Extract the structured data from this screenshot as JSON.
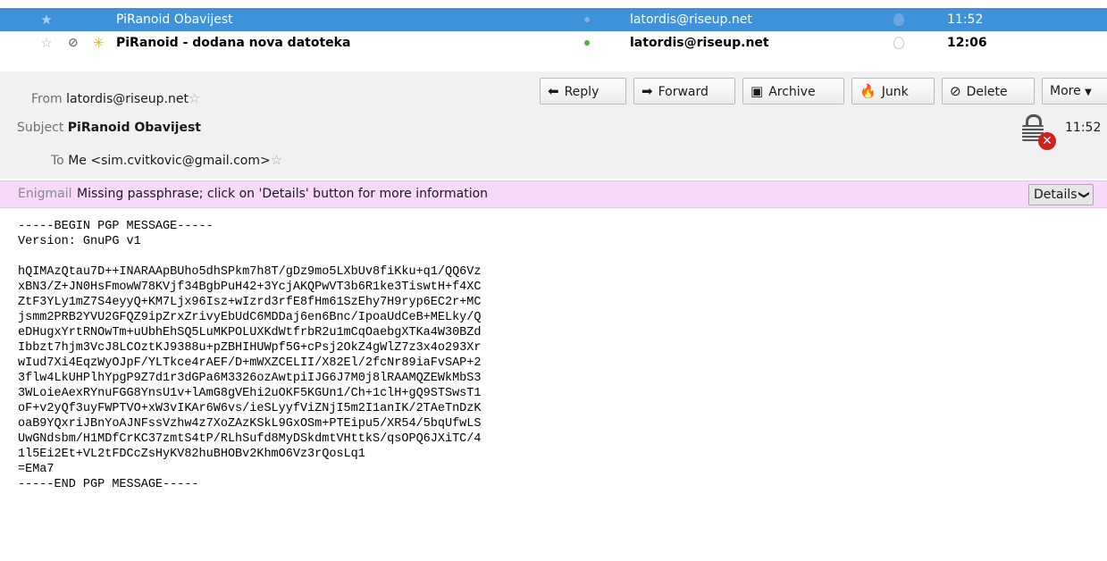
{
  "message_list": {
    "rows": [
      {
        "subject": "PiRanoid Obavijest",
        "from": "latordis@riseup.net",
        "time": "11:52",
        "selected": true
      },
      {
        "subject": "PiRanoid - dodana nova datoteka",
        "from": "latordis@riseup.net",
        "time": "12:06",
        "selected": false
      }
    ]
  },
  "toolbar": {
    "reply": "Reply",
    "forward": "Forward",
    "archive": "Archive",
    "junk": "Junk",
    "delete": "Delete",
    "more": "More"
  },
  "header": {
    "from_label": "From",
    "from_value": "latordis@riseup.net",
    "subject_label": "Subject",
    "subject_value": "PiRanoid Obavijest",
    "to_label": "To",
    "to_value": "Me <sim.cvitkovic@gmail.com>",
    "time": "11:52"
  },
  "enigmail": {
    "label": "Enigmail",
    "message": "Missing passphrase; click on 'Details' button for more information",
    "details_button": "Details"
  },
  "body": {
    "lines": [
      "-----BEGIN PGP MESSAGE-----",
      "Version: GnuPG v1",
      "",
      "hQIMAzQtau7D++INARAApBUho5dhSPkm7h8T/gDz9mo5LXbUv8fiKku+q1/QQ6Vz",
      "xBN3/Z+JN0HsFmowW78KVjf34BgbPuH42+3YcjAKQPwVT3b6R1ke3TiswtH+f4XC",
      "ZtF3YLy1mZ7S4eyyQ+KM7Ljx96Isz+wIzrd3rfE8fHm61SzEhy7H9ryp6EC2r+MC",
      "jsmm2PRB2YVU2GFQZ9ipZrxZrivyEbUdC6MDDaj6en6Bnc/IpoaUdCeB+MELky/Q",
      "eDHugxYrtRNOwTm+uUbhEhSQ5LuMKPOLUXKdWtfrbR2u1mCqOaebgXTKa4W30BZd",
      "Ibbzt7hjm3VcJ8LCOztKJ9388u+pZBHIHUWpf5G+cPsj2OkZ4gWlZ7z3x4o293Xr",
      "wIud7Xi4EqzWyOJpF/YLTkce4rAEF/D+mWXZCELII/X82El/2fcNr89iaFvSAP+2",
      "3flw4LkUHPlhYpgP9Z7d1r3dGPa6M3326ozAwtpiIJG6J7M0j8lRAAMQZEWkMbS3",
      "3WLoieAexRYnuFGG8YnsU1v+lAmG8gVEhi2uOKF5KGUn1/Ch+1clH+gQ9STSwsT1",
      "oF+v2yQf3uyFWPTVO+xW3vIKAr6W6vs/ieSLyyfViZNjI5m2I1anIK/2TAeTnDzK",
      "oaB9YQxriJBnYoAJNFssVzhw4z7XoZAzKSkL9GxOSm+PTEipu5/XR54/5bqUfwLS",
      "UwGNdsbm/H1MDfCrKC37zmtS4tP/RLhSufd8MyDSkdmtVHttkS/qsOPQ6JXiTC/4",
      "1l5Ei2Et+VL2tFDCcZsHyKV82huBHOBv2KhmO6Vz3rQosLq1",
      "=EMa7",
      "-----END PGP MESSAGE-----"
    ]
  },
  "colors": {
    "selection": "#3d92d9",
    "banner": "#f7d9f8",
    "header_bg": "#f1f1f1",
    "error_badge": "#d21f1f",
    "online_dot": "#52b043"
  }
}
